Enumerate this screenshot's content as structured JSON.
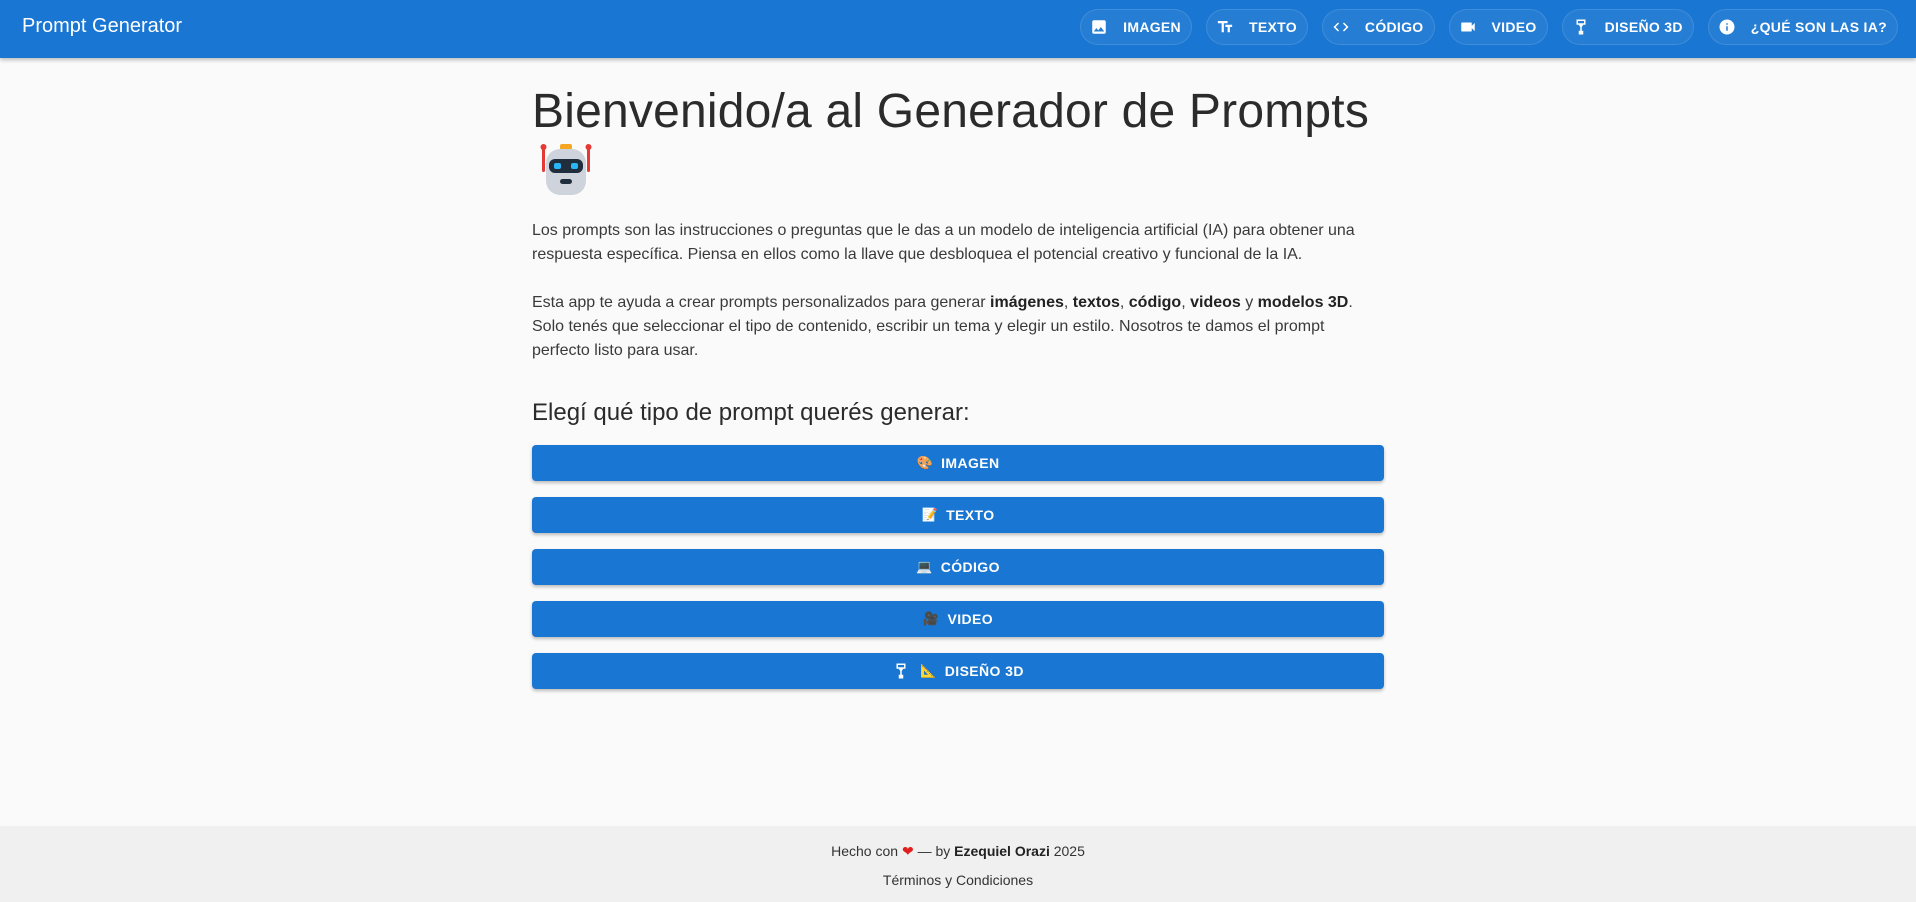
{
  "app": {
    "title": "Prompt Generator"
  },
  "nav": [
    {
      "label": "IMAGEN",
      "icon": "image-icon"
    },
    {
      "label": "TEXTO",
      "icon": "text-fields-icon"
    },
    {
      "label": "CÓDIGO",
      "icon": "code-icon"
    },
    {
      "label": "VIDEO",
      "icon": "videocam-icon"
    },
    {
      "label": "DISEÑO 3D",
      "icon": "3d-print-icon"
    },
    {
      "label": "¿QUÉ SON LAS IA?",
      "icon": "info-icon"
    }
  ],
  "main": {
    "title": "Bienvenido/a al Generador de Prompts",
    "title_emoji": "robot-icon",
    "intro1": "Los prompts son las instrucciones o preguntas que le das a un modelo de inteligencia artificial (IA) para obtener una respuesta específica. Piensa en ellos como la llave que desbloquea el potencial creativo y funcional de la IA.",
    "intro2": {
      "part1": "Esta app te ayuda a crear prompts personalizados para generar ",
      "b1": "imágenes",
      "sep1": ", ",
      "b2": "textos",
      "sep2": ", ",
      "b3": "código",
      "sep3": ", ",
      "b4": "videos",
      "sep4": " y ",
      "b5": "modelos 3D",
      "part2": ". Solo tenés que seleccionar el tipo de contenido, escribir un tema y elegir un estilo. Nosotros te damos el prompt perfecto listo para usar."
    },
    "subtitle": "Elegí qué tipo de prompt querés generar:",
    "choices": [
      {
        "emoji": "🎨",
        "label": "IMAGEN"
      },
      {
        "emoji": "📝",
        "label": "TEXTO"
      },
      {
        "emoji": "💻",
        "label": "CÓDIGO"
      },
      {
        "emoji": "🎥",
        "label": "VIDEO"
      },
      {
        "emoji": "📐",
        "label": "DISEÑO 3D"
      }
    ]
  },
  "footer": {
    "made_with": "Hecho con",
    "heart": "❤",
    "by": "— by",
    "author": "Ezequiel Orazi",
    "year": "2025",
    "terms": "Términos y Condiciones"
  },
  "colors": {
    "primary": "#1976d2",
    "background": "#fafafa",
    "footer": "#f0f0f0"
  }
}
